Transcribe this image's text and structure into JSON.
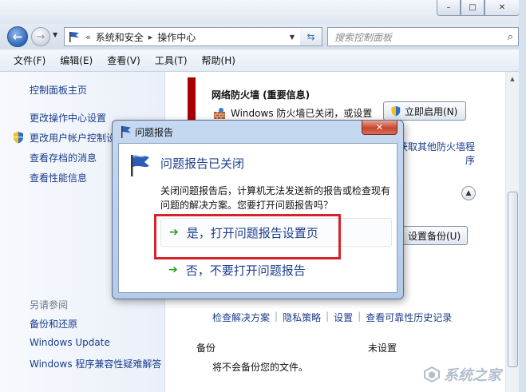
{
  "window": {
    "minimize_glyph": "–",
    "maximize_glyph": "□",
    "close_glyph": "✕"
  },
  "nav": {
    "address": {
      "overflow": "«",
      "crumbs": [
        "系统和安全",
        "操作中心"
      ],
      "separator": "▸"
    },
    "search_placeholder": "搜索控制面板"
  },
  "menubar": {
    "items": [
      "文件(F)",
      "编辑(E)",
      "查看(V)",
      "工具(T)",
      "帮助(H)"
    ]
  },
  "sidebar": {
    "home": "控制面板主页",
    "links": [
      "更改操作中心设置",
      "更改用户帐户控制设置",
      "查看存档的消息",
      "查看性能信息"
    ],
    "see_also_title": "另请参阅",
    "see_also": [
      "备份和还原",
      "Windows Update",
      "Windows 程序兼容性疑难解答"
    ]
  },
  "main": {
    "firewall_title": "网络防火墙 (重要信息)",
    "firewall_text": "Windows 防火墙已关闭，或设置",
    "turn_on_button": "立即启用(N)",
    "other_firewall": "获取其他防火墙程序",
    "backup_button": "设置备份(U)",
    "links": [
      "检查解决方案",
      "隐私策略",
      "设置",
      "查看可靠性历史记录"
    ],
    "backup_label": "备份",
    "backup_status": "未设置",
    "backup_desc": "将不会备份您的文件。"
  },
  "dialog": {
    "title": "问题报告",
    "heading": "问题报告已关闭",
    "text": "关闭问题报告后，计算机无法发送新的报告或检查现有问题的解决方案。您要打开问题报告吗？",
    "option_yes": "是，打开问题报告设置页",
    "option_no": "否，不要打开问题报告"
  },
  "watermark": {
    "text": "系统之家"
  },
  "colors": {
    "link": "#1b3d8c",
    "alert_bar": "#a80000",
    "highlight_box": "#d6232a",
    "dialog_heading": "#1e3f8f"
  }
}
